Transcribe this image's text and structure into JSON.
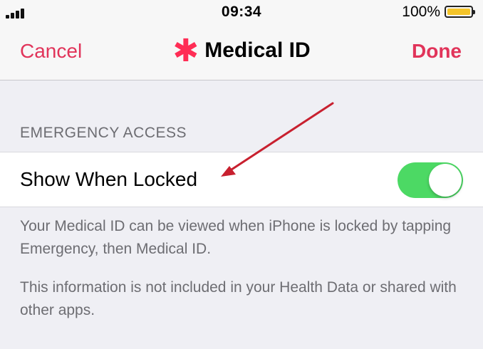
{
  "status_bar": {
    "time": "09:34",
    "battery_percent": "100%",
    "battery_level": 1.0,
    "battery_color": "#f5c52a"
  },
  "nav": {
    "cancel_label": "Cancel",
    "title": "Medical ID",
    "title_icon": "medical-asterisk-icon",
    "done_label": "Done",
    "accent_color": "#e1345a"
  },
  "section": {
    "header": "EMERGENCY ACCESS"
  },
  "row": {
    "label": "Show When Locked",
    "toggle_on": true,
    "toggle_color": "#4cd964"
  },
  "footer": {
    "text_1": "Your Medical ID can be viewed when iPhone is locked by tapping Emergency, then Medical ID.",
    "text_2": "This information is not included in your Health Data or shared with other apps."
  },
  "annotation": {
    "arrow_color": "#c8202f"
  }
}
